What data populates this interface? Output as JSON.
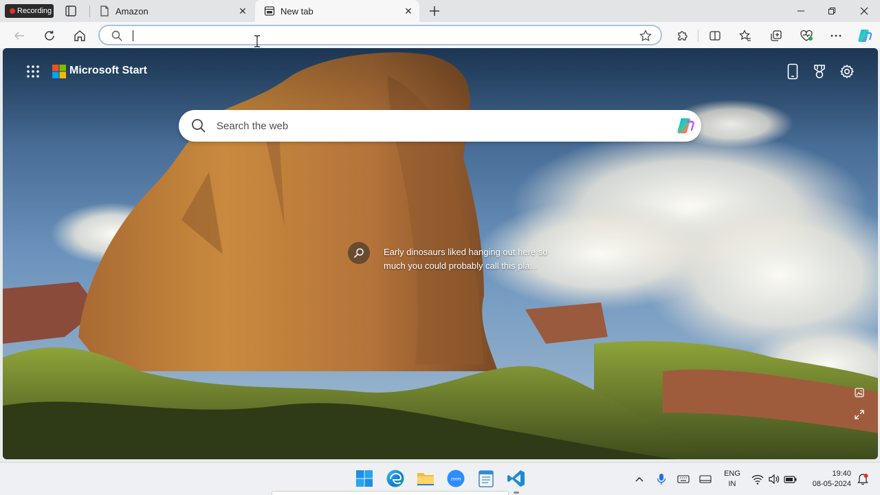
{
  "recording_badge": {
    "label": "Recording"
  },
  "tabs": [
    {
      "title": "Amazon",
      "icon": "document-icon",
      "active": false
    },
    {
      "title": "New tab",
      "icon": "newtab-icon",
      "active": true
    }
  ],
  "omnibox": {
    "value": "",
    "placeholder": ""
  },
  "page": {
    "brand": "Microsoft Start",
    "search_placeholder": "Search the web",
    "fact_text": "Early dinosaurs liked hanging out here so much you could probably call this pla..."
  },
  "taskbar": {
    "language_line1": "ENG",
    "language_line2": "IN",
    "time": "19:40",
    "date": "08-05-2024"
  },
  "colors": {
    "omnibox_border": "#a9c1de",
    "recording_red": "#e0322b",
    "ms_red": "#f25022",
    "ms_green": "#7fba00",
    "ms_blue": "#00a4ef",
    "ms_yellow": "#ffb900"
  }
}
